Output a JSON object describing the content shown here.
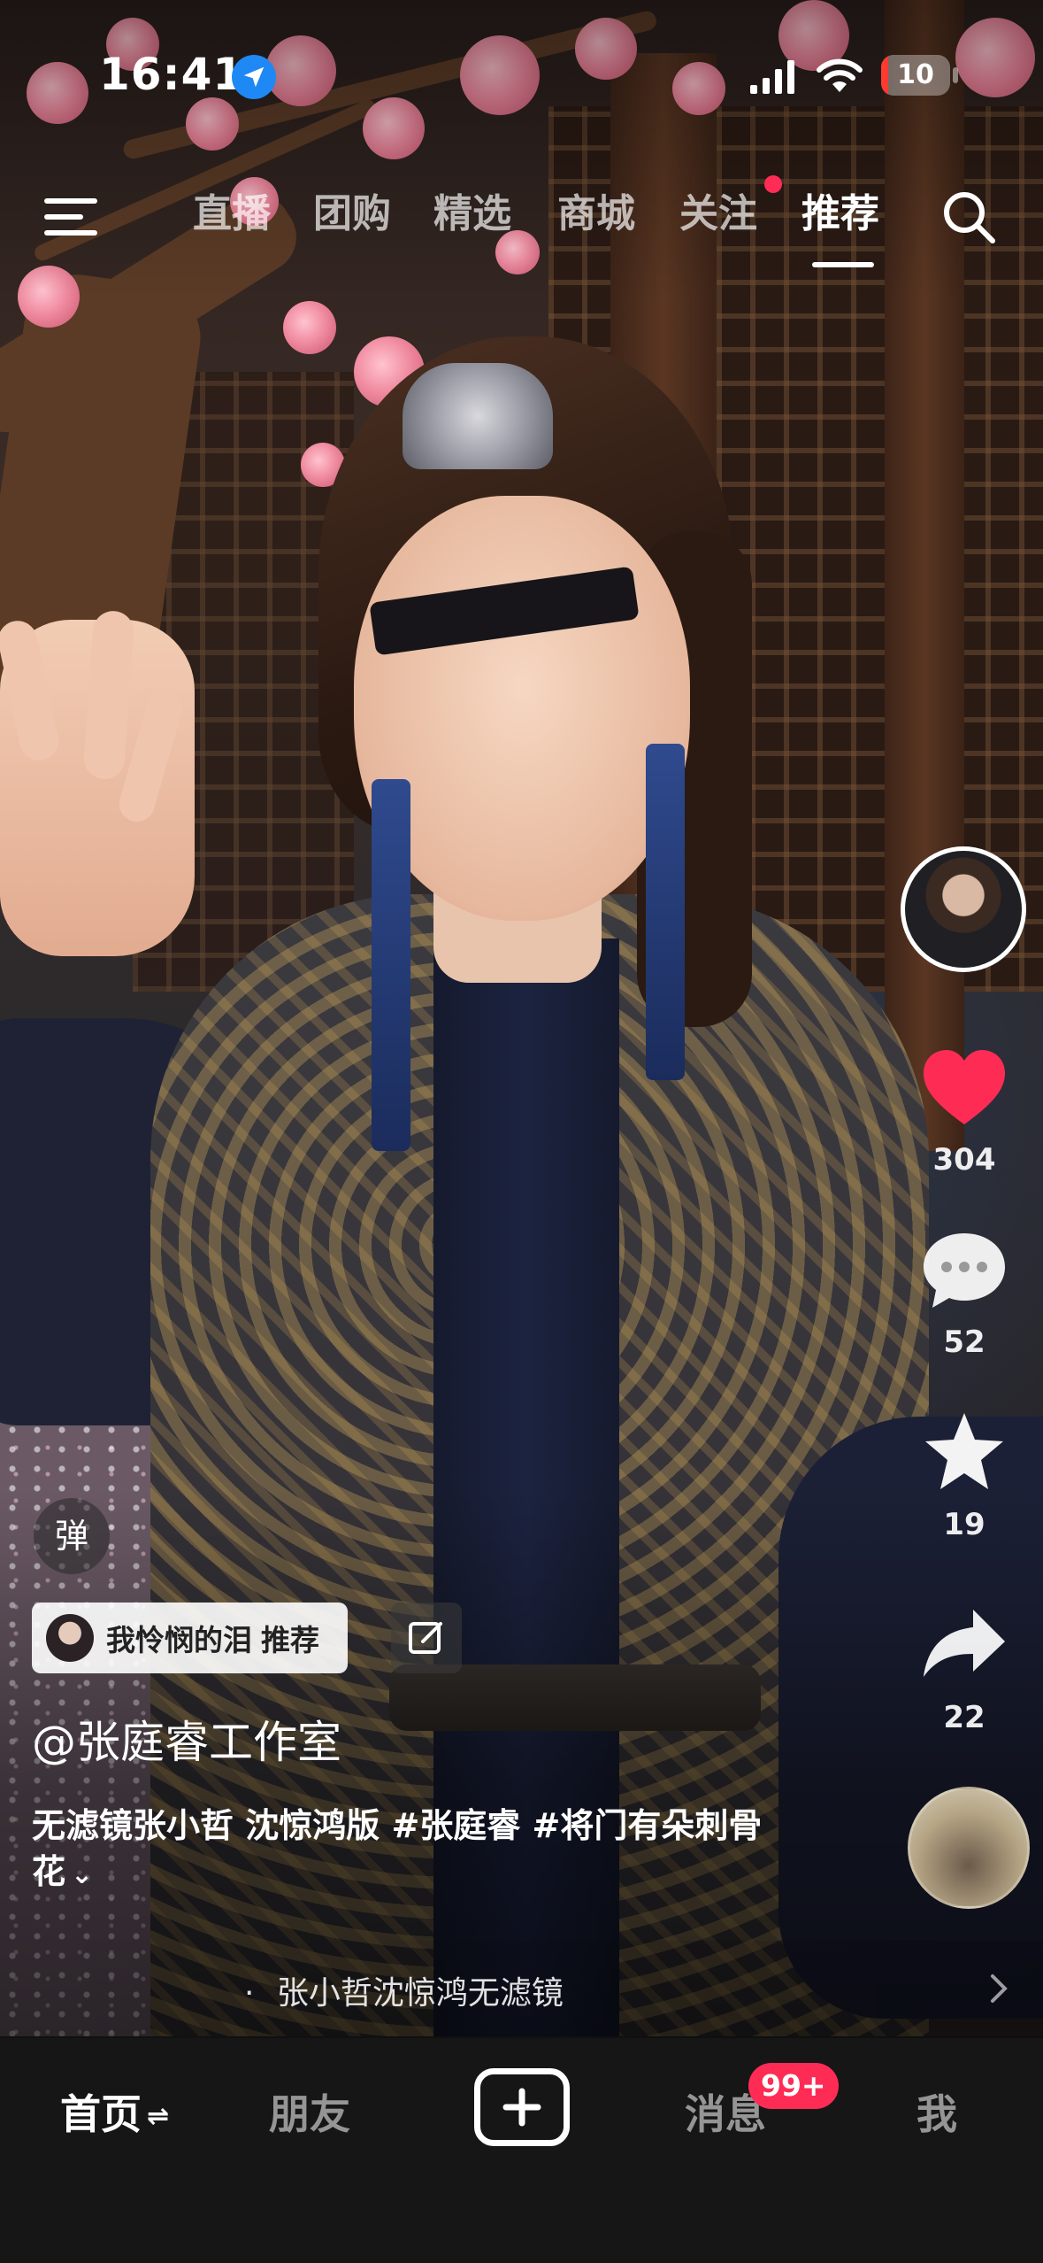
{
  "status_bar": {
    "time": "16:41",
    "battery": "10",
    "battery_color": "#ff3b30",
    "location_icon": "location-arrow-icon",
    "signal_icon": "cellular-signal-icon",
    "wifi_icon": "wifi-icon"
  },
  "top_nav": {
    "menu_icon": "hamburger-menu-icon",
    "tabs": [
      {
        "label": "直播"
      },
      {
        "label": "团购"
      },
      {
        "label": "精选"
      },
      {
        "label": "商城"
      },
      {
        "label": "关注"
      },
      {
        "label": "推荐"
      }
    ],
    "active_tab": "推荐",
    "search_icon": "search-icon"
  },
  "actions": {
    "likes": "304",
    "comments": "52",
    "favorites": "19",
    "shares": "22",
    "like_color": "#fe2c55"
  },
  "post": {
    "danmu_label": "弹",
    "recommender_name": "我怜悯的泪",
    "recommend_label": "推荐",
    "author": "@张庭睿工作室",
    "description": "无滤镜张小哲 沈惊鸿版 #张庭睿 #将门有朵刺骨花",
    "more_icon": "chevron-down-icon",
    "music_prefix": "·",
    "music_title": "张小哲沈惊鸿无滤镜"
  },
  "bottom_nav": {
    "home": "首页",
    "home_swap": "⇌",
    "friends": "朋友",
    "messages": "消息",
    "messages_badge": "99+",
    "me": "我",
    "badge_color": "#fe2c55"
  }
}
